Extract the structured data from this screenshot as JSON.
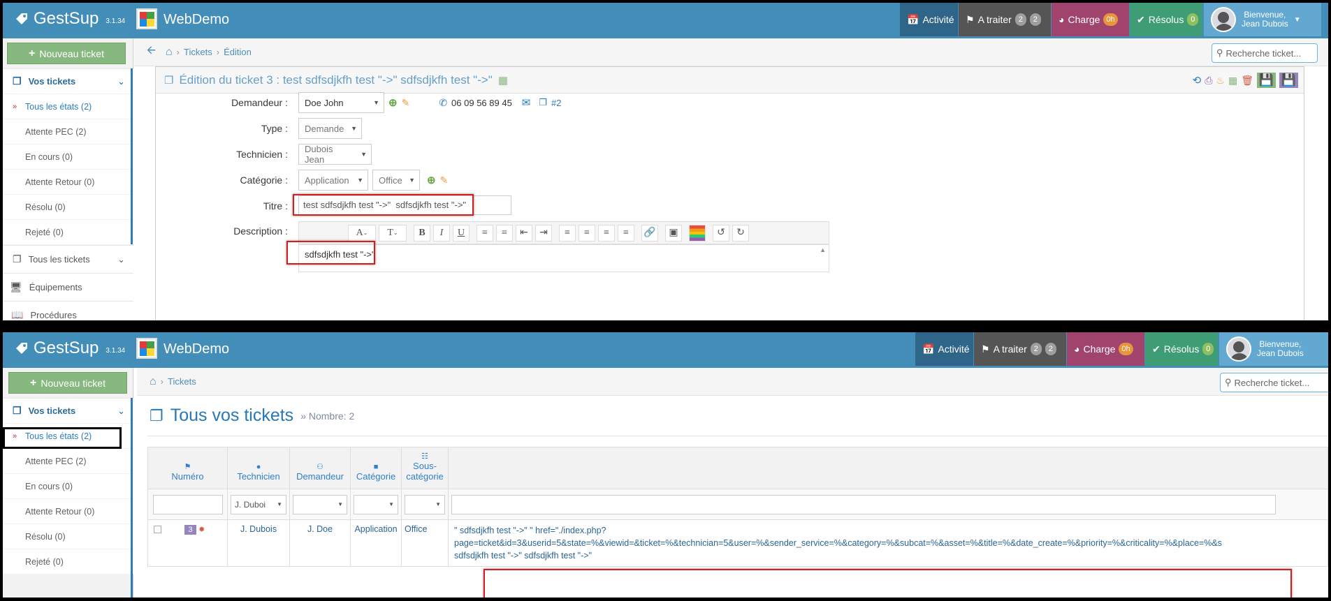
{
  "app": {
    "name": "GestSup",
    "version": "3.1.34",
    "site": "WebDemo"
  },
  "nav": {
    "activity": "Activité",
    "to_process": "A traiter",
    "to_process_badges": [
      "2",
      "2"
    ],
    "load": "Charge",
    "load_badge": "0h",
    "resolved": "Résolus",
    "resolved_badge": "0",
    "welcome": "Bienvenue,",
    "user": "Jean Dubois"
  },
  "sidebar": {
    "new_ticket": "Nouveau ticket",
    "your_tickets": "Vos tickets",
    "items": [
      "Tous les états (2)",
      "Attente PEC (2)",
      "En cours (0)",
      "Attente Retour (0)",
      "Résolu (0)",
      "Rejeté (0)"
    ],
    "all_tickets": "Tous les tickets",
    "equipment": "Équipements",
    "procedures": "Procédures"
  },
  "panel1": {
    "breadcrumb": [
      "Tickets",
      "Édition"
    ],
    "search_placeholder": "Recherche ticket...",
    "edit_title": "Édition du ticket 3 : test sdfsdjkfh test \"->\" sdfsdjkfh test \"->\"",
    "form": {
      "requester_label": "Demandeur :",
      "requester_value": "Doe John",
      "phone": "06 09 56 89 45",
      "ticket_link": "#2",
      "type_label": "Type :",
      "type_value": "Demande",
      "technician_label": "Technicien :",
      "technician_value": "Dubois Jean",
      "category_label": "Catégorie :",
      "category_value": "Application",
      "subcategory_value": "Office",
      "title_label": "Titre :",
      "title_value": "test sdfsdjkfh test \"->\"  sdfsdjkfh test \"->\"",
      "description_label": "Description :",
      "description_value": "sdfsdjkfh test \"->\""
    }
  },
  "panel2": {
    "breadcrumb": [
      "Tickets"
    ],
    "search_placeholder": "Recherche ticket...",
    "page_title": "Tous vos tickets",
    "count": "Nombre: 2",
    "columns": [
      "Numéro",
      "Technicien",
      "Demandeur",
      "Catégorie",
      "Sous-catégorie"
    ],
    "filter_technician": "J. Duboi",
    "row": {
      "number": "3",
      "technician": "J. Dubois",
      "requester": "J. Doe",
      "category": "Application",
      "subcategory": "Office",
      "title_line1": "\" sdfsdjkfh test \"->\" \" href=\"./index.php?",
      "title_line2": "page=ticket&id=3&userid=5&state=%&viewid=&ticket=%&technician=5&user=%&sender_service=%&category=%&subcat=%&asset=%&title=%&date_create=%&priority=%&criticality=%&place=%&s",
      "title_line3": "sdfsdjkfh test \"->\" sdfsdjkfh test \"->\""
    }
  },
  "colors": {
    "navbar": "#438eb9",
    "activity": "#2e6589",
    "to_process": "#555555",
    "load": "#a0446d",
    "resolved": "#3e9d75",
    "new_ticket": "#87b87f",
    "link": "#2b7dbc"
  }
}
